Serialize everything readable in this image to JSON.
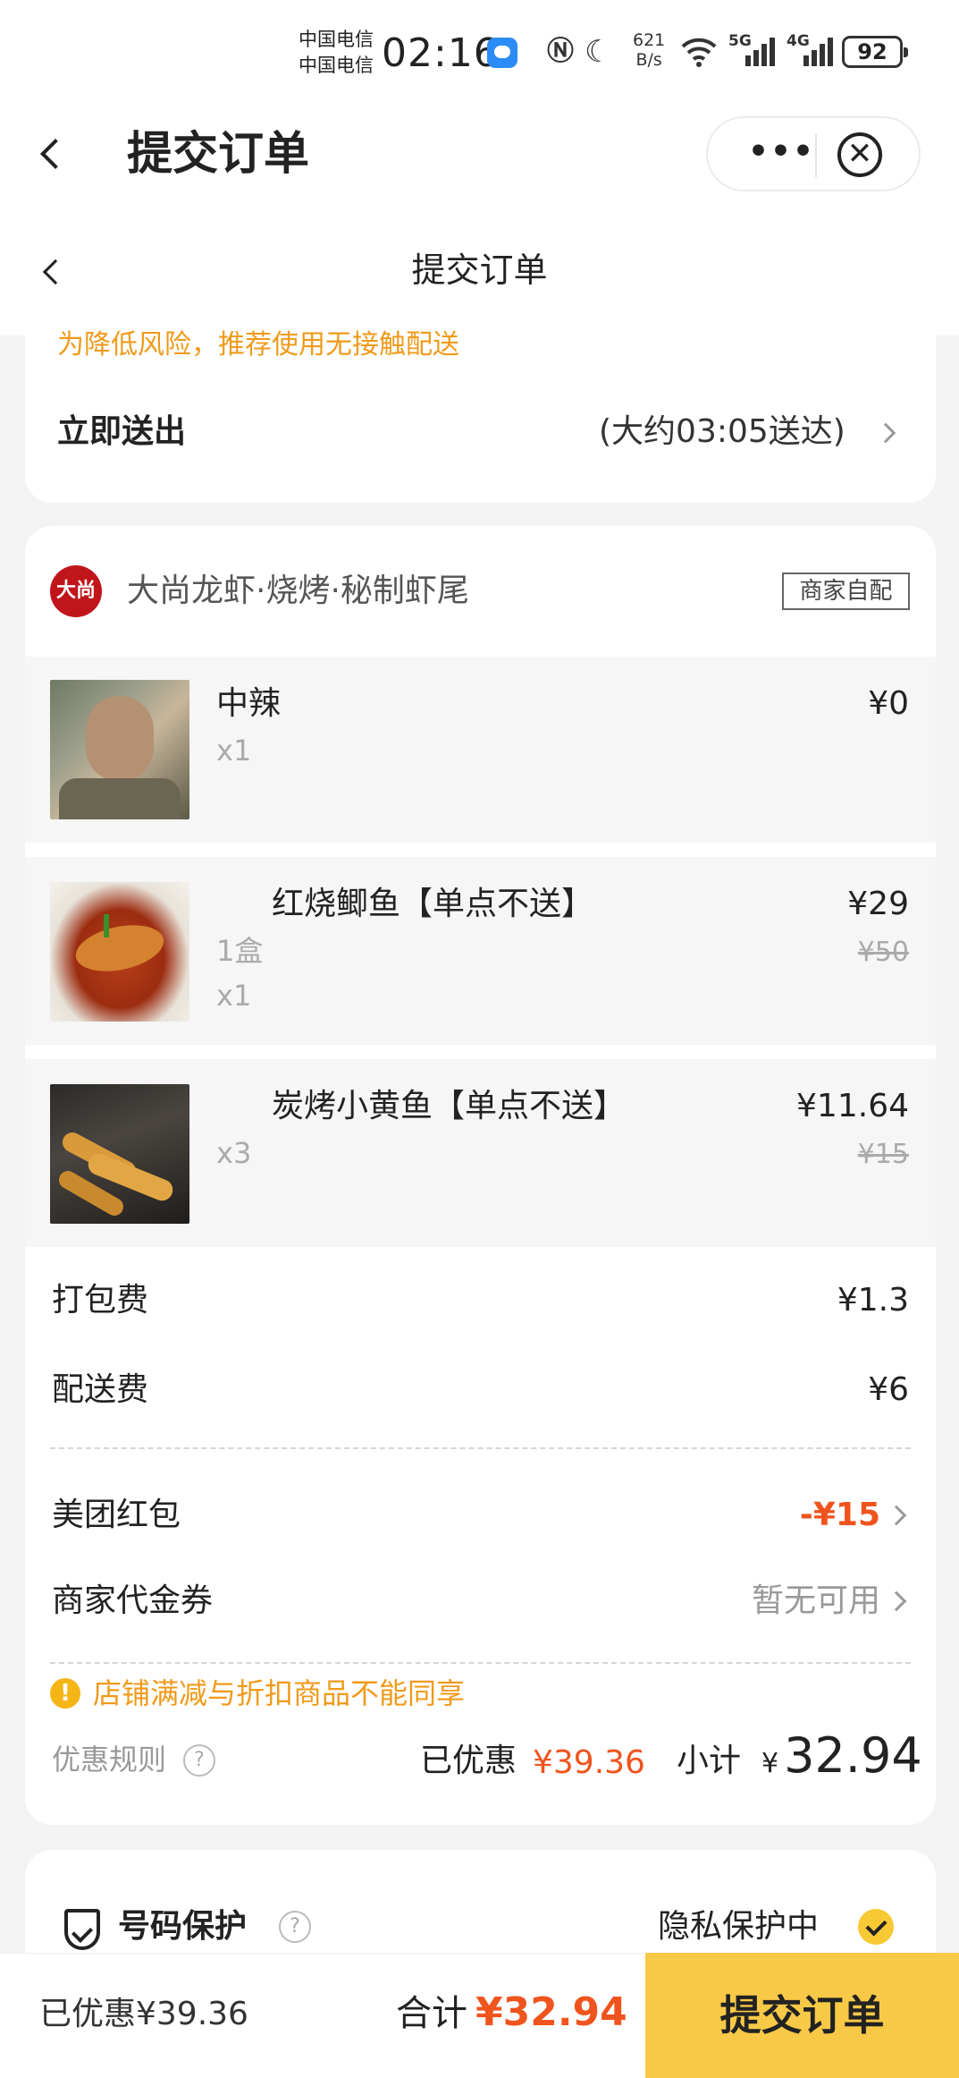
{
  "status_bar": {
    "carrier_1": "中国电信",
    "carrier_2": "中国电信",
    "time": "02:16",
    "speed_value": "621",
    "speed_unit": "B/s",
    "net_5g": "5G",
    "net_4g": "4G",
    "battery": "92"
  },
  "app_header": {
    "title": "提交订单",
    "more_label": "•••",
    "close_label": "✕"
  },
  "page_header": {
    "title": "提交订单"
  },
  "delivery": {
    "warning": "为降低风险，推荐使用无接触配送",
    "mode": "立即送出",
    "eta": "(大约03:05送达)"
  },
  "shop": {
    "logo_text": "大尚",
    "name": "大尚龙虾·烧烤·秘制虾尾",
    "badge": "商家自配"
  },
  "items": [
    {
      "name": "中辣",
      "spec": "",
      "qty": "x1",
      "price": "¥0",
      "original_price": ""
    },
    {
      "name": "红烧鲫鱼【单点不送】",
      "spec": "1盒",
      "qty": "x1",
      "price": "¥29",
      "original_price": "¥50"
    },
    {
      "name": "炭烤小黄鱼【单点不送】",
      "spec": "",
      "qty": "x3",
      "price": "¥11.64",
      "original_price": "¥15"
    }
  ],
  "fees": {
    "packing_label": "打包费",
    "packing_value": "¥1.3",
    "delivery_label": "配送费",
    "delivery_value": "¥6"
  },
  "coupons": {
    "redpacket_label": "美团红包",
    "redpacket_value": "-¥15",
    "voucher_label": "商家代金券",
    "voucher_value": "暂无可用"
  },
  "summary": {
    "notice": "店铺满减与折扣商品不能同享",
    "rules_label": "优惠规则",
    "discount_label": "已优惠",
    "discount_value": "¥39.36",
    "subtotal_label": "小计",
    "subtotal_symbol": "¥",
    "subtotal_value": "32.94"
  },
  "privacy": {
    "title": "号码保护",
    "status": "隐私保护中"
  },
  "bottom_bar": {
    "discount_text": "已优惠¥39.36",
    "total_label": "合计",
    "total_value": "¥32.94",
    "submit_label": "提交订单"
  },
  "colors": {
    "accent_yellow": "#f8c947",
    "price_red": "#f0541e",
    "warning_orange": "#f09a1a"
  }
}
